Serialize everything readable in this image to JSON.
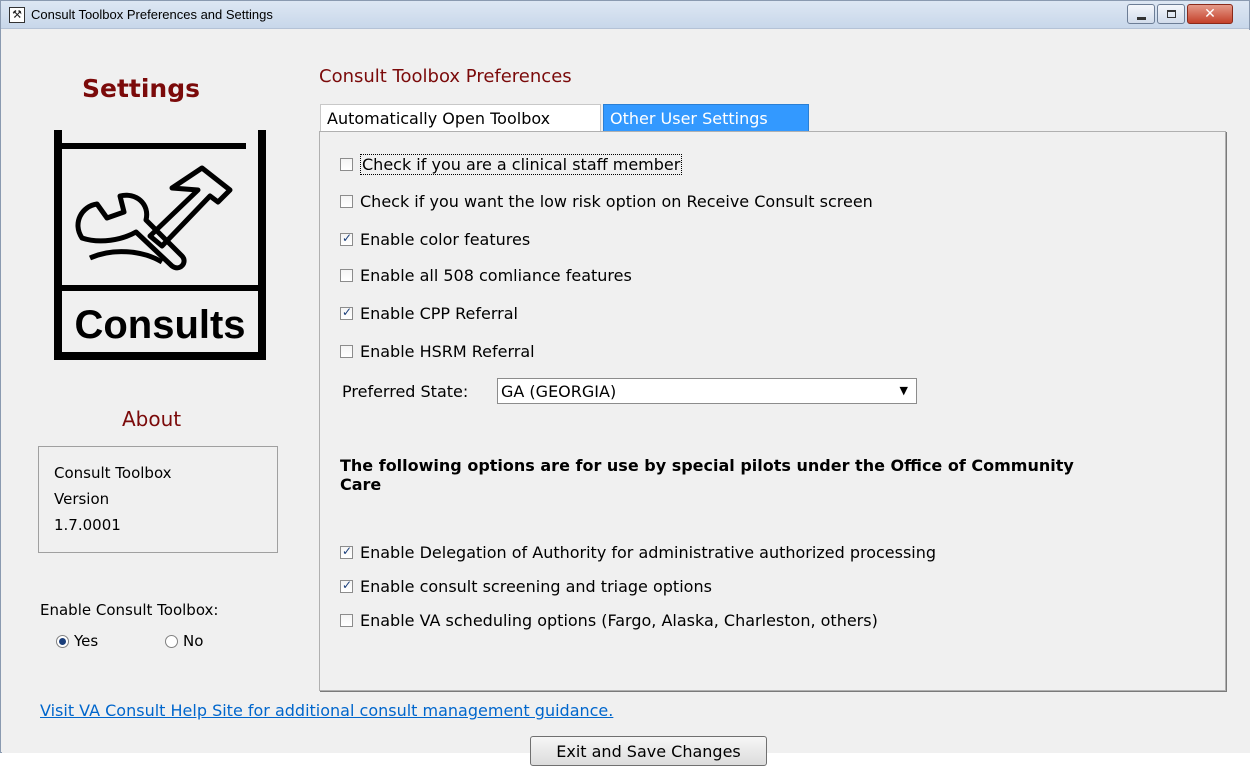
{
  "window": {
    "title": "Consult Toolbox Preferences and Settings"
  },
  "left": {
    "settings_heading": "Settings",
    "logo_text": "Consults",
    "about_heading": "About",
    "about_lines": [
      "Consult Toolbox",
      "Version",
      "1.7.0001"
    ],
    "enable_label": "Enable Consult Toolbox:",
    "radio_yes": "Yes",
    "radio_no": "No",
    "enable_selected": "Yes"
  },
  "main": {
    "heading": "Consult Toolbox Preferences",
    "tabs": [
      {
        "label": "Automatically Open Toolbox",
        "active": false
      },
      {
        "label": "Other User Settings",
        "active": true
      }
    ],
    "options": [
      {
        "label": "Check if you are a clinical staff member",
        "checked": false
      },
      {
        "label": "Check if you want the low risk option on Receive Consult screen",
        "checked": false
      },
      {
        "label": "Enable color features",
        "checked": true
      },
      {
        "label": "Enable all 508 comliance features",
        "checked": false
      },
      {
        "label": "Enable CPP Referral",
        "checked": true
      },
      {
        "label": "Enable HSRM Referral",
        "checked": false
      }
    ],
    "preferred_state_label": "Preferred State:",
    "preferred_state_value": "GA (GEORGIA)",
    "pilot_heading": "The following options are for use by special pilots under the Office of Community Care",
    "pilot_options": [
      {
        "label": "Enable Delegation of Authority for administrative authorized processing",
        "checked": true
      },
      {
        "label": "Enable consult screening and triage options",
        "checked": true
      },
      {
        "label": "Enable VA scheduling options (Fargo, Alaska, Charleston, others)",
        "checked": false
      }
    ]
  },
  "footer": {
    "help_link": "Visit VA Consult Help Site for additional consult management guidance.",
    "exit_button": "Exit and Save Changes"
  }
}
